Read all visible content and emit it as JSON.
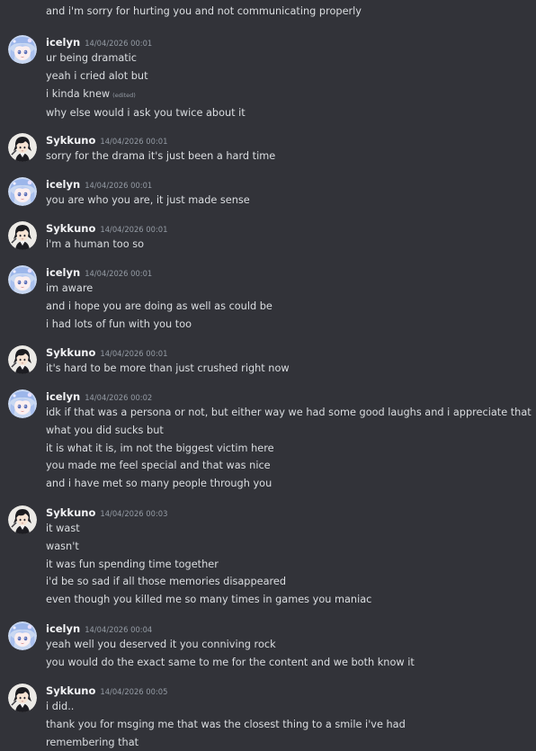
{
  "top_continuation": "and i'm sorry for hurting you and not communicating properly",
  "edited_label": "(edited)",
  "users": {
    "icelyn": {
      "name": "icelyn",
      "avatar": "icelyn-avatar"
    },
    "sykkuno": {
      "name": "Sykkuno",
      "avatar": "sykkuno-avatar"
    }
  },
  "messages": [
    {
      "user": "icelyn",
      "timestamp": "14/04/2026 00:01",
      "lines": [
        {
          "text": "ur being dramatic"
        },
        {
          "text": "yeah i cried alot but"
        },
        {
          "text": "i kinda knew",
          "edited": true
        },
        {
          "text": "why else would i ask you twice about it"
        }
      ]
    },
    {
      "user": "Sykkuno",
      "timestamp": "14/04/2026 00:01",
      "lines": [
        {
          "text": "sorry for the drama it's just been a hard time"
        }
      ]
    },
    {
      "user": "icelyn",
      "timestamp": "14/04/2026 00:01",
      "lines": [
        {
          "text": "you are who you are, it just made sense"
        }
      ]
    },
    {
      "user": "Sykkuno",
      "timestamp": "14/04/2026 00:01",
      "lines": [
        {
          "text": "i'm a human too so"
        }
      ]
    },
    {
      "user": "icelyn",
      "timestamp": "14/04/2026 00:01",
      "lines": [
        {
          "text": "im aware"
        },
        {
          "text": "and i hope you are doing as well as could be"
        },
        {
          "text": "i had lots of fun with you too"
        }
      ]
    },
    {
      "user": "Sykkuno",
      "timestamp": "14/04/2026 00:01",
      "lines": [
        {
          "text": "it's hard to be more than just crushed right now"
        }
      ]
    },
    {
      "user": "icelyn",
      "timestamp": "14/04/2026 00:02",
      "lines": [
        {
          "text": "idk if that was a persona or not, but either way we had some good laughs and i appreciate that"
        },
        {
          "text": "what you did sucks but"
        },
        {
          "text": "it is what it is, im not the biggest victim here"
        },
        {
          "text": "you made me feel special and that was nice"
        },
        {
          "text": "and i have met so many people through you"
        }
      ]
    },
    {
      "user": "Sykkuno",
      "timestamp": "14/04/2026 00:03",
      "lines": [
        {
          "text": "it wast"
        },
        {
          "text": "wasn't"
        },
        {
          "text": "it was fun spending time together"
        },
        {
          "text": "i'd be so sad if all those memories disappeared"
        },
        {
          "text": "even though you killed me so many times in games you maniac"
        }
      ]
    },
    {
      "user": "icelyn",
      "timestamp": "14/04/2026 00:04",
      "lines": [
        {
          "text": "yeah well you deserved it you conniving rock"
        },
        {
          "text": "you would do the exact same to me for the content and we both know it"
        }
      ]
    },
    {
      "user": "Sykkuno",
      "timestamp": "14/04/2026 00:05",
      "lines": [
        {
          "text": "i did.."
        },
        {
          "text": "thank you for msging me that was the closest thing to a smile i've had"
        },
        {
          "text": "remembering that"
        }
      ]
    }
  ]
}
